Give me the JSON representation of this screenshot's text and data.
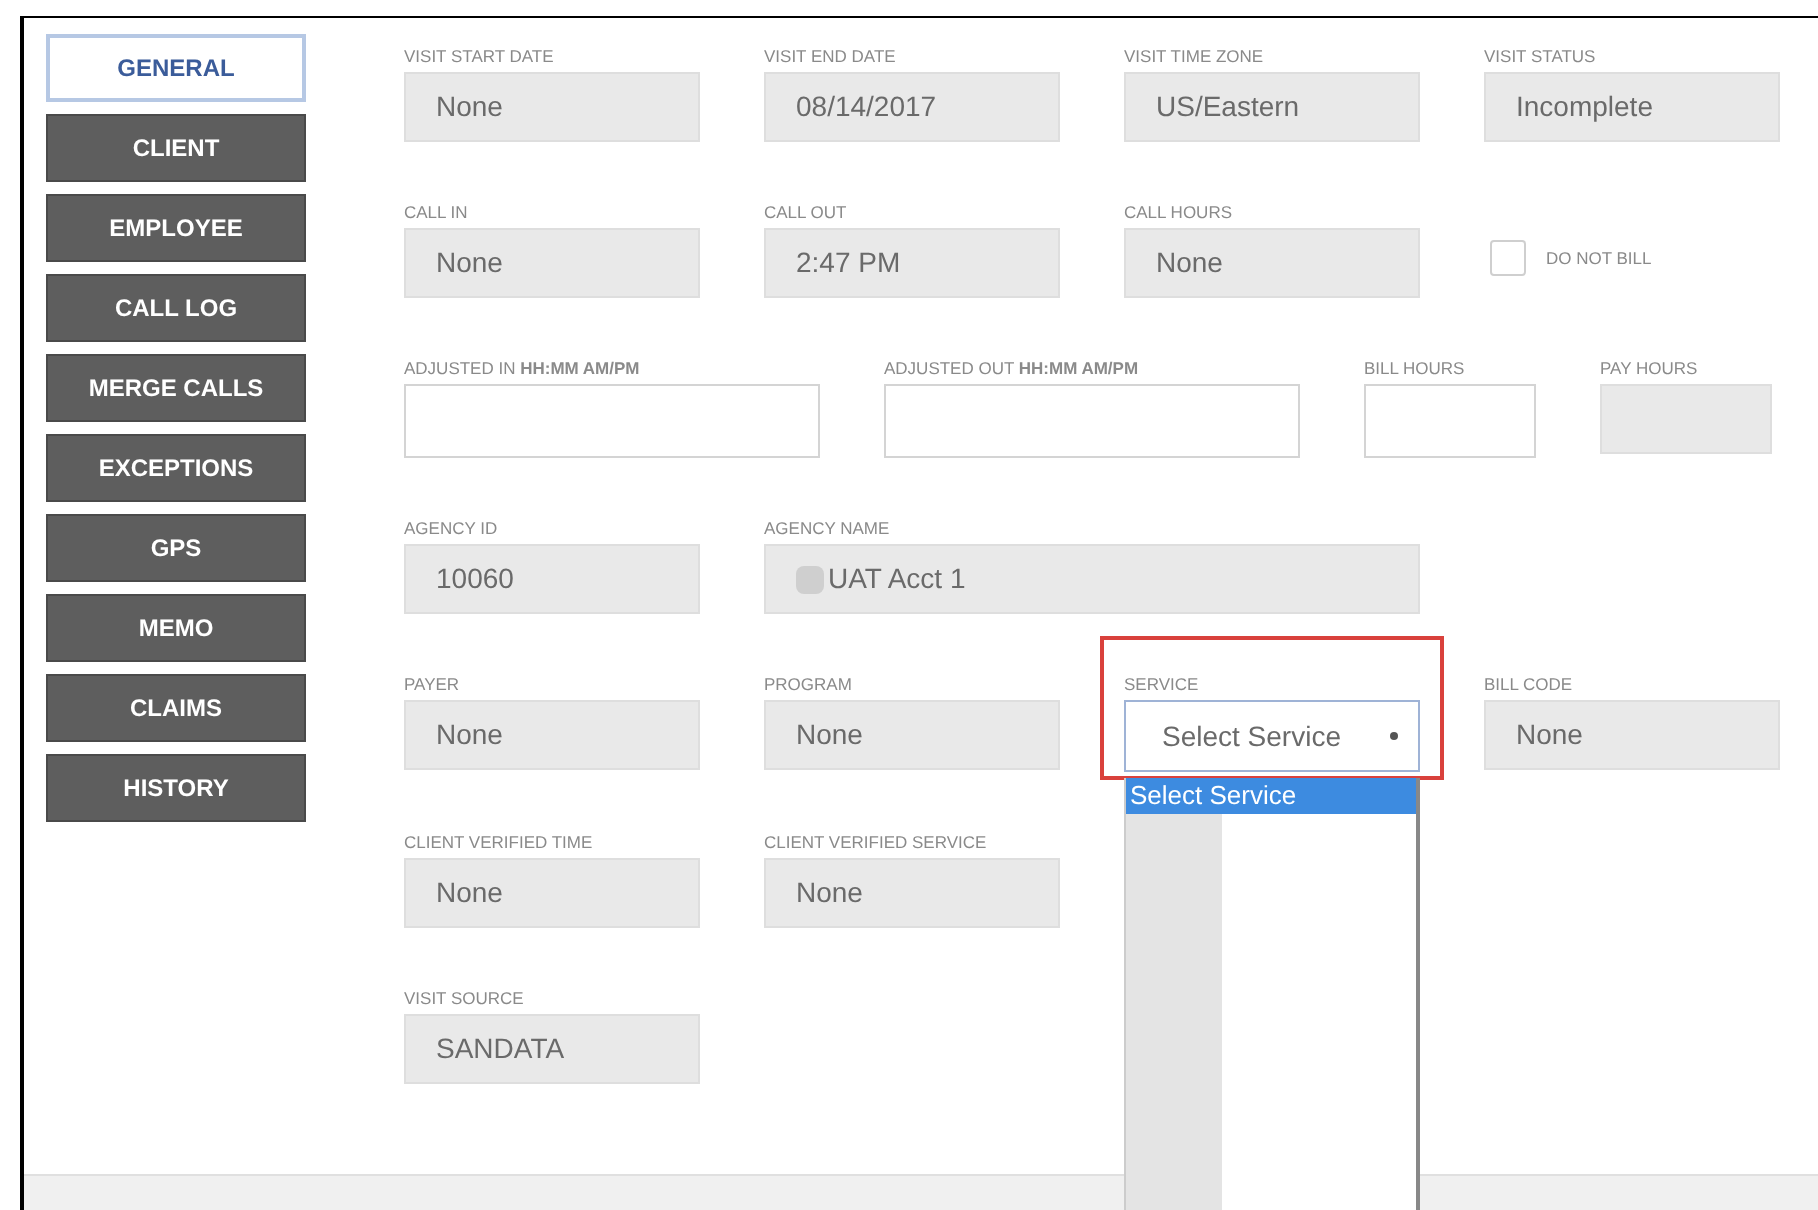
{
  "sidebar": {
    "items": [
      {
        "label": "GENERAL",
        "selected": true
      },
      {
        "label": "CLIENT",
        "selected": false
      },
      {
        "label": "EMPLOYEE",
        "selected": false
      },
      {
        "label": "CALL LOG",
        "selected": false
      },
      {
        "label": "MERGE CALLS",
        "selected": false
      },
      {
        "label": "EXCEPTIONS",
        "selected": false
      },
      {
        "label": "GPS",
        "selected": false
      },
      {
        "label": "MEMO",
        "selected": false
      },
      {
        "label": "CLAIMS",
        "selected": false
      },
      {
        "label": "HISTORY",
        "selected": false
      }
    ]
  },
  "rows": [
    {
      "fields": [
        {
          "kind": "readonly",
          "label": "VISIT START DATE",
          "value": "None"
        },
        {
          "kind": "readonly",
          "label": "VISIT END DATE",
          "value": "08/14/2017"
        },
        {
          "kind": "readonly",
          "label": "VISIT TIME ZONE",
          "value": "US/Eastern"
        },
        {
          "kind": "readonly",
          "label": "VISIT STATUS",
          "value": "Incomplete"
        }
      ]
    },
    {
      "fields": [
        {
          "kind": "readonly",
          "label": "CALL IN",
          "value": "None"
        },
        {
          "kind": "readonly",
          "label": "CALL OUT",
          "value": "2:47 PM"
        },
        {
          "kind": "readonly",
          "label": "CALL HOURS",
          "value": "None"
        },
        {
          "kind": "checkbox",
          "label": "DO NOT BILL",
          "checked": false
        }
      ]
    },
    {
      "fields": [
        {
          "kind": "input-wide",
          "label": "ADJUSTED IN **HH:MM AM/PM**"
        },
        {
          "kind": "input-wide",
          "label": "ADJUSTED OUT **HH:MM AM/PM**"
        },
        {
          "kind": "input-narrow",
          "label": "BILL HOURS"
        },
        {
          "kind": "readonly-narrow",
          "label": "PAY HOURS"
        }
      ]
    },
    {
      "fields": [
        {
          "kind": "readonly",
          "label": "AGENCY ID",
          "value": "10060"
        },
        {
          "kind": "readonly-wide",
          "label": "AGENCY NAME",
          "value": "UAT Acct 1",
          "redacted": true
        }
      ]
    },
    {
      "fields": [
        {
          "kind": "readonly",
          "label": "PAYER",
          "value": "None"
        },
        {
          "kind": "readonly",
          "label": "PROGRAM",
          "value": "None"
        },
        {
          "kind": "select",
          "label": "SERVICE",
          "value": "Select Service",
          "highlighted": true,
          "expanded": true,
          "options": [
            {
              "label": "Select Service",
              "selected": true
            }
          ]
        },
        {
          "kind": "readonly",
          "label": "BILL CODE",
          "value": "None"
        }
      ]
    },
    {
      "fields": [
        {
          "kind": "readonly",
          "label": "CLIENT VERIFIED TIME",
          "value": "None"
        },
        {
          "kind": "readonly",
          "label": "CLIENT VERIFIED SERVICE",
          "value": "None"
        }
      ]
    },
    {
      "fields": [
        {
          "kind": "readonly",
          "label": "VISIT SOURCE",
          "value": "SANDATA"
        }
      ]
    }
  ]
}
